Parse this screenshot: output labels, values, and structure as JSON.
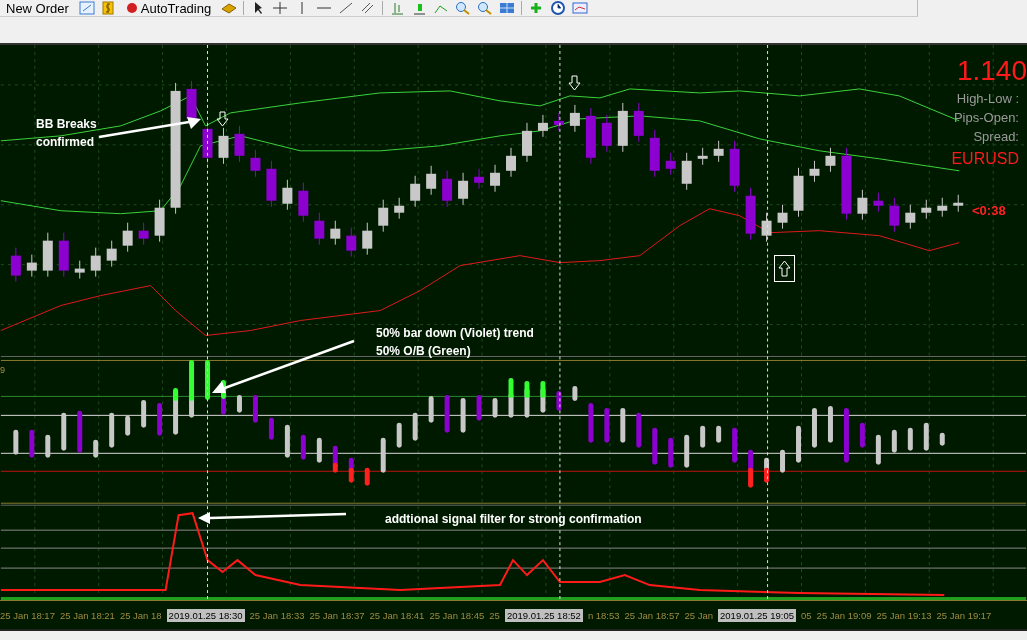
{
  "toolbar": {
    "buttons": [
      {
        "label": "New Order"
      },
      {
        "label": "AutoTrading"
      }
    ]
  },
  "chart": {
    "price": "1.140",
    "info_labels": [
      "High-Low :",
      "Pips-Open:",
      "Spread:"
    ],
    "symbol": "EURUSD",
    "bar_timer": "<0:38",
    "indicator_level": "9",
    "annotations": [
      {
        "kind": "bb",
        "text": "BB Breaks confirmed"
      },
      {
        "kind": "trend",
        "text": "50% bar down (Violet) trend"
      },
      {
        "kind": "ob",
        "text": "50% O/B (Green)"
      },
      {
        "kind": "filter",
        "text": "addtional signal filter for strong confirmation"
      }
    ]
  },
  "time_axis": {
    "labels": [
      {
        "kind": "tick",
        "text": "25 Jan 18:17"
      },
      {
        "kind": "tick",
        "text": "25 Jan 18:21"
      },
      {
        "kind": "tick",
        "text": "25 Jan 18"
      },
      {
        "kind": "cursor",
        "text": "2019.01.25 18:30"
      },
      {
        "kind": "tick",
        "text": "25 Jan 18:33"
      },
      {
        "kind": "tick",
        "text": "25 Jan 18:37"
      },
      {
        "kind": "tick",
        "text": "25 Jan 18:41"
      },
      {
        "kind": "tick",
        "text": "25 Jan 18:45"
      },
      {
        "kind": "tick",
        "text": "25"
      },
      {
        "kind": "cursor",
        "text": "2019.01.25 18:52"
      },
      {
        "kind": "tick",
        "text": "n 18:53"
      },
      {
        "kind": "tick",
        "text": "25 Jan 18:57"
      },
      {
        "kind": "tick",
        "text": "25 Jan"
      },
      {
        "kind": "cursor",
        "text": "2019.01.25 19:05"
      },
      {
        "kind": "tick",
        "text": "05"
      },
      {
        "kind": "tick",
        "text": "25 Jan 19:09"
      },
      {
        "kind": "tick",
        "text": "25 Jan 19:13"
      },
      {
        "kind": "tick",
        "text": "25 Jan 19:17"
      }
    ]
  }
}
